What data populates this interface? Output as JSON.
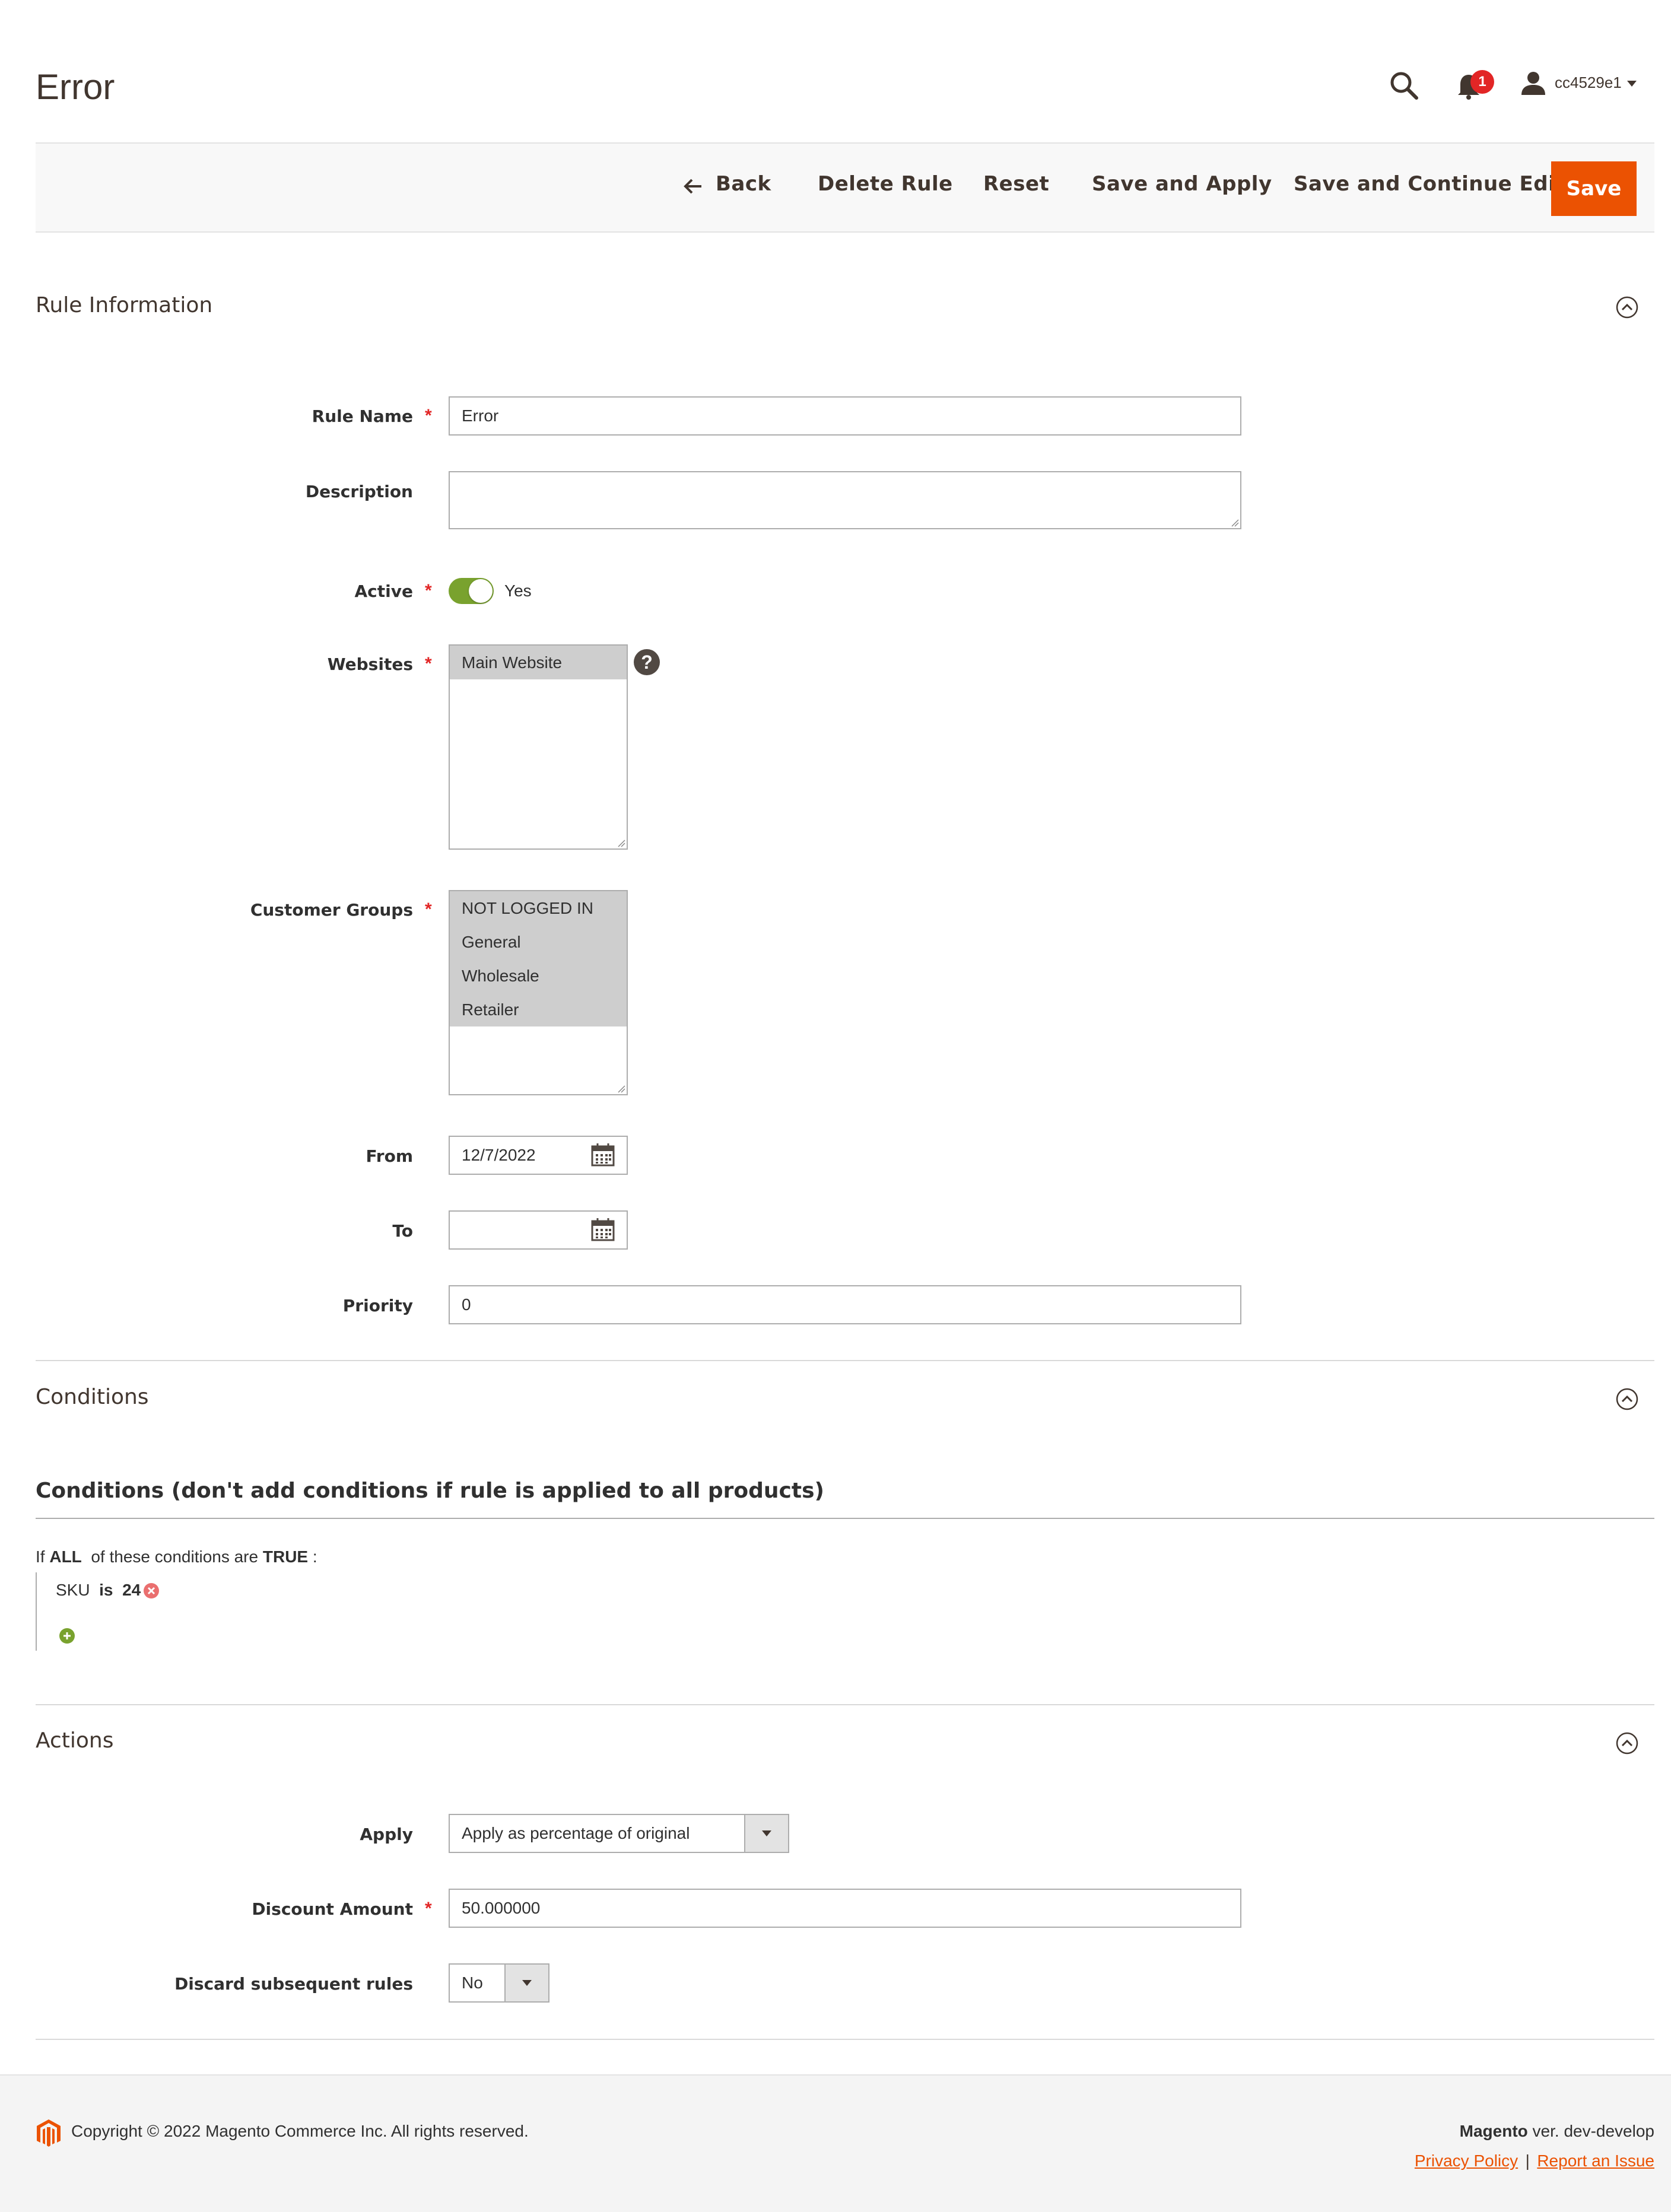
{
  "header": {
    "page_title": "Error",
    "notification_count": "1",
    "username": "cc4529e1"
  },
  "toolbar": {
    "back_label": "Back",
    "delete_label": "Delete Rule",
    "reset_label": "Reset",
    "save_apply_label": "Save and Apply",
    "save_continue_label": "Save and Continue Edit",
    "save_label": "Save"
  },
  "rule_info": {
    "section_title": "Rule Information",
    "rule_name_label": "Rule Name",
    "rule_name_value": "Error",
    "description_label": "Description",
    "description_value": "",
    "active_label": "Active",
    "active_value": "Yes",
    "websites_label": "Websites",
    "websites_options": [
      "Main Website"
    ],
    "customer_groups_label": "Customer Groups",
    "customer_groups_options": [
      "NOT LOGGED IN",
      "General",
      "Wholesale",
      "Retailer"
    ],
    "from_label": "From",
    "from_value": "12/7/2022",
    "to_label": "To",
    "to_value": "",
    "priority_label": "Priority",
    "priority_value": "0",
    "required_mark": "*",
    "help_mark": "?"
  },
  "conditions": {
    "section_title": "Conditions",
    "heading": "Conditions (don't add conditions if rule is applied to all products)",
    "sentence_if": "If",
    "sentence_all": "ALL",
    "sentence_mid": "of these conditions are",
    "sentence_true": "TRUE",
    "sentence_end": ":",
    "cond_attr": "SKU",
    "cond_op": "is",
    "cond_value": "24"
  },
  "actions": {
    "section_title": "Actions",
    "apply_label": "Apply",
    "apply_value": "Apply as percentage of original",
    "discount_label": "Discount Amount",
    "discount_value": "50.000000",
    "discard_label": "Discard subsequent rules",
    "discard_value": "No"
  },
  "footer": {
    "copyright": "Copyright © 2022 Magento Commerce Inc. All rights reserved.",
    "brand": "Magento",
    "version": "ver. dev-develop",
    "privacy_link": "Privacy Policy",
    "separator": "|",
    "report_link": "Report an Issue"
  },
  "colors": {
    "accent": "#eb5202",
    "toggle_on": "#79a22e",
    "required": "#e22626"
  }
}
